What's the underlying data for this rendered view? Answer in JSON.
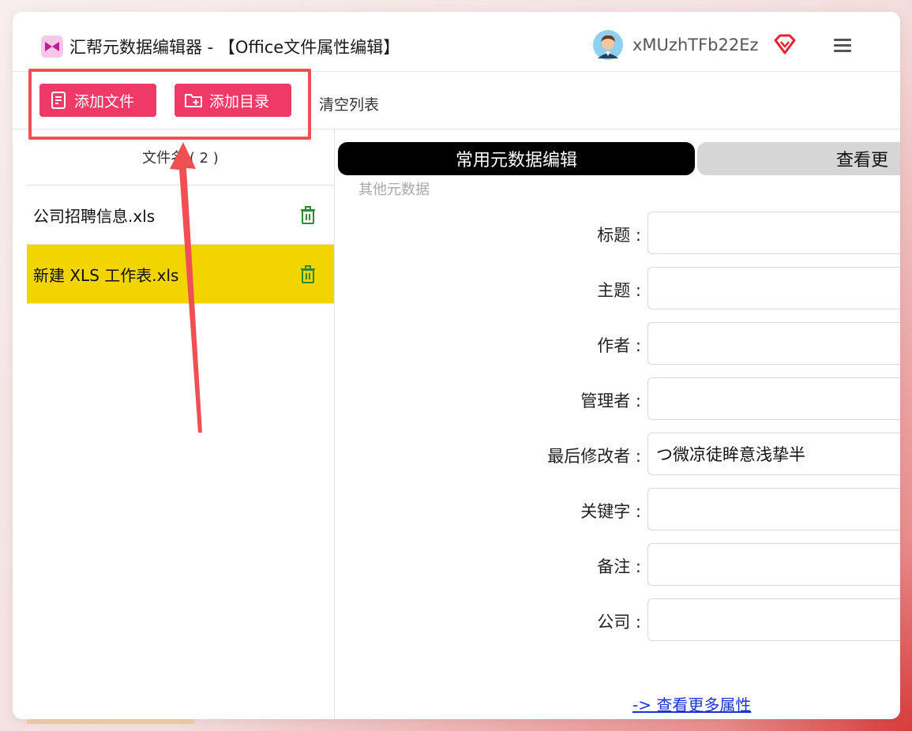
{
  "app": {
    "title": "汇帮元数据编辑器 - 【Office文件属性编辑】",
    "username": "xMUzhTFb22Ez",
    "accent_color": "#ef3a67",
    "vip_color": "#e8212e"
  },
  "toolbar": {
    "add_file_label": "添加文件",
    "add_dir_label": "添加目录",
    "clear_label": "清空列表"
  },
  "file_list": {
    "header": "文件名 ( 2 )",
    "items": [
      {
        "name": "公司招聘信息.xls"
      },
      {
        "name": "新建 XLS 工作表.xls"
      }
    ]
  },
  "tabs": {
    "active_label": "常用元数据编辑",
    "inactive_label": "查看更",
    "sub_caption": "其他元数据"
  },
  "form": {
    "fields": [
      {
        "label": "标题 :",
        "value": ""
      },
      {
        "label": "主题 :",
        "value": ""
      },
      {
        "label": "作者 :",
        "value": ""
      },
      {
        "label": "管理者 :",
        "value": ""
      },
      {
        "label": "最后修改者 :",
        "value": "つ微凉徒眸意浅挚半"
      },
      {
        "label": "关键字 :",
        "value": ""
      },
      {
        "label": "备注 :",
        "value": ""
      },
      {
        "label": "公司 :",
        "value": ""
      }
    ],
    "more_link": "-> 查看更多属性"
  }
}
